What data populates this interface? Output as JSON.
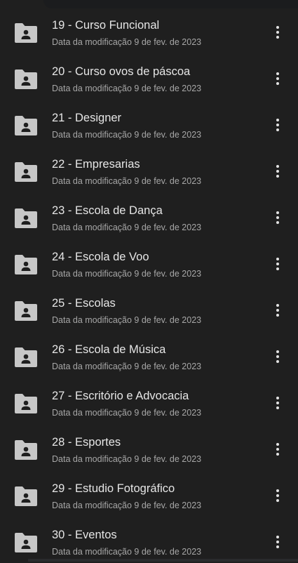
{
  "colors": {
    "background": "#1f1f1f",
    "title_text": "#e6e6e6",
    "meta_text": "#a7a7a7",
    "folder_icon": "#c7c7c7"
  },
  "files": [
    {
      "name": "19 - Curso Funcional",
      "modified": "Data da modificação 9 de fev. de 2023",
      "icon": "shared-folder-icon"
    },
    {
      "name": "20 - Curso ovos de páscoa",
      "modified": "Data da modificação 9 de fev. de 2023",
      "icon": "shared-folder-icon"
    },
    {
      "name": "21 - Designer",
      "modified": "Data da modificação 9 de fev. de 2023",
      "icon": "shared-folder-icon"
    },
    {
      "name": "22 - Empresarias",
      "modified": "Data da modificação 9 de fev. de 2023",
      "icon": "shared-folder-icon"
    },
    {
      "name": "23 - Escola de Dança",
      "modified": "Data da modificação 9 de fev. de 2023",
      "icon": "shared-folder-icon"
    },
    {
      "name": "24 - Escola de Voo",
      "modified": "Data da modificação 9 de fev. de 2023",
      "icon": "shared-folder-icon"
    },
    {
      "name": "25 - Escolas",
      "modified": "Data da modificação 9 de fev. de 2023",
      "icon": "shared-folder-icon"
    },
    {
      "name": "26 - Escola de Música",
      "modified": "Data da modificação 9 de fev. de 2023",
      "icon": "shared-folder-icon"
    },
    {
      "name": "27 - Escritório e Advocacia",
      "modified": "Data da modificação 9 de fev. de 2023",
      "icon": "shared-folder-icon"
    },
    {
      "name": "28 - Esportes",
      "modified": "Data da modificação 9 de fev. de 2023",
      "icon": "shared-folder-icon"
    },
    {
      "name": "29 - Estudio Fotográfico",
      "modified": "Data da modificação 9 de fev. de 2023",
      "icon": "shared-folder-icon"
    },
    {
      "name": "30 - Eventos",
      "modified": "Data da modificação 9 de fev. de 2023",
      "icon": "shared-folder-icon"
    }
  ]
}
